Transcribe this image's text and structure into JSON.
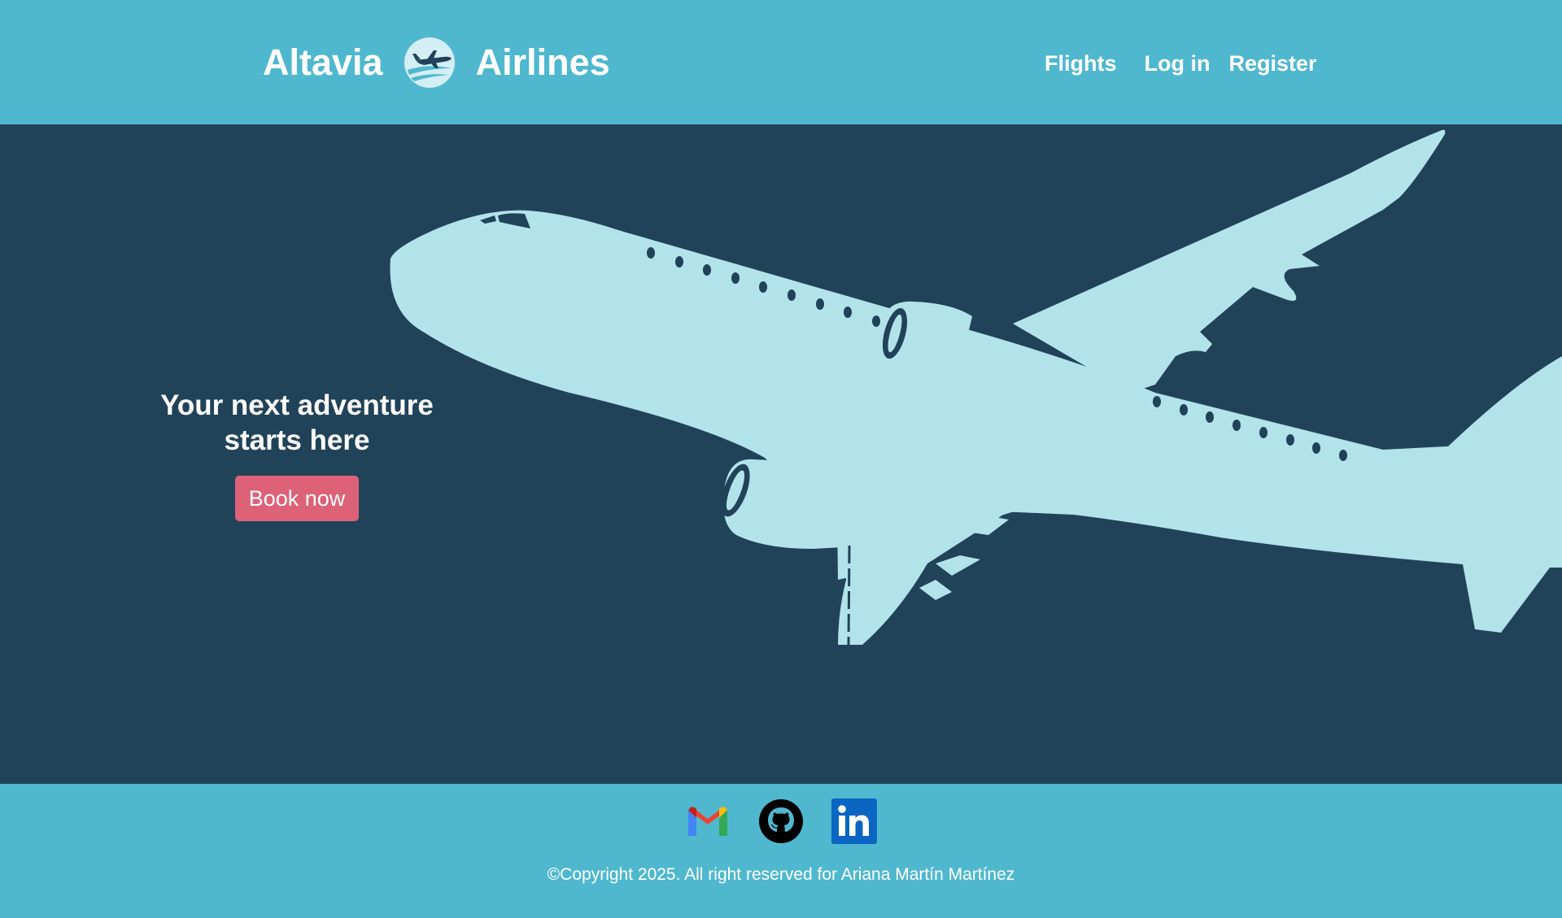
{
  "header": {
    "brand_left": "Altavia",
    "brand_right": "Airlines",
    "logo_icon": "airplane-logo-icon",
    "nav": {
      "flights": "Flights",
      "login": "Log in",
      "register": "Register"
    }
  },
  "hero": {
    "title_line1": "Your next adventure",
    "title_line2": "starts here",
    "cta": "Book now",
    "illustration": "airplane-silhouette"
  },
  "footer": {
    "socials": [
      "gmail-icon",
      "github-icon",
      "linkedin-icon"
    ],
    "copyright": "©Copyright 2025. All right reserved for Ariana Martín Martínez"
  },
  "colors": {
    "header_bg": "#4fb8cf",
    "hero_bg": "#21435a",
    "plane": "#b2e3ea",
    "cta_bg": "#dd6278",
    "text": "#ffffff"
  }
}
